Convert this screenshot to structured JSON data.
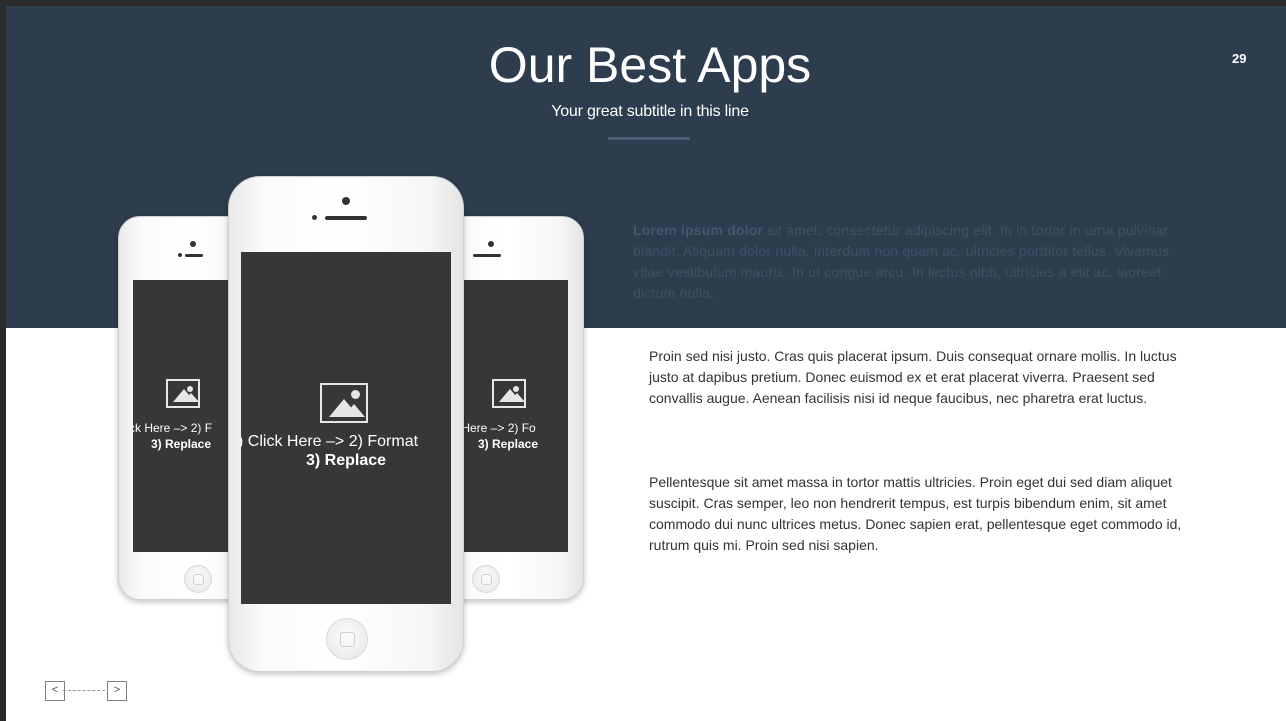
{
  "slide": {
    "title": "Our Best Apps",
    "subtitle": "Your great subtitle in this line",
    "page_number": "29"
  },
  "lead": {
    "bold": "Lorem ipsum dolor",
    "text": " sit amet, consectetur adipiscing elit. In in tortor in urna pulvinar blandit. Aliquam dolor nulla, interdum non quam ac, ultricies porttitor tellus. Vivamus vitae vestibulum mauris. In ut congue arcu. In lectus nibh, ultricies a elit ac, laoreet dictum nulla."
  },
  "paragraphs": [
    "Proin sed nisi justo. Cras quis placerat ipsum. Duis consequat ornare mollis. In luctus justo at dapibus pretium. Donec euismod ex et erat placerat viverra. Praesent sed convallis augue. Aenean facilisis nisi id neque faucibus, nec pharetra erat luctus.",
    "Pellentesque sit amet massa in tortor mattis ultricies. Proin eget dui sed diam aliquet suscipit. Cras semper, leo non hendrerit tempus, est turpis bibendum enim, sit amet commodo dui nunc ultrices metus. Donec sapien erat, pellentesque eget commodo id, rutrum quis mi. Proin sed nisi sapien."
  ],
  "phones": {
    "left": {
      "line1": "ck Here –> 2) F",
      "line2": "3) Replace"
    },
    "center": {
      "line1": ") Click Here –> 2) Format",
      "line2": "3) Replace"
    },
    "right": {
      "line1": "ck Here –> 2) Fo",
      "line2": "3) Replace"
    }
  },
  "nav": {
    "prev": "<",
    "next": ">"
  },
  "colors": {
    "band": "#2d3d4d",
    "screen": "#373737",
    "lead_text": "#3f5163"
  },
  "icons": [
    "image-placeholder-icon",
    "chevron-left-icon",
    "chevron-right-icon"
  ]
}
